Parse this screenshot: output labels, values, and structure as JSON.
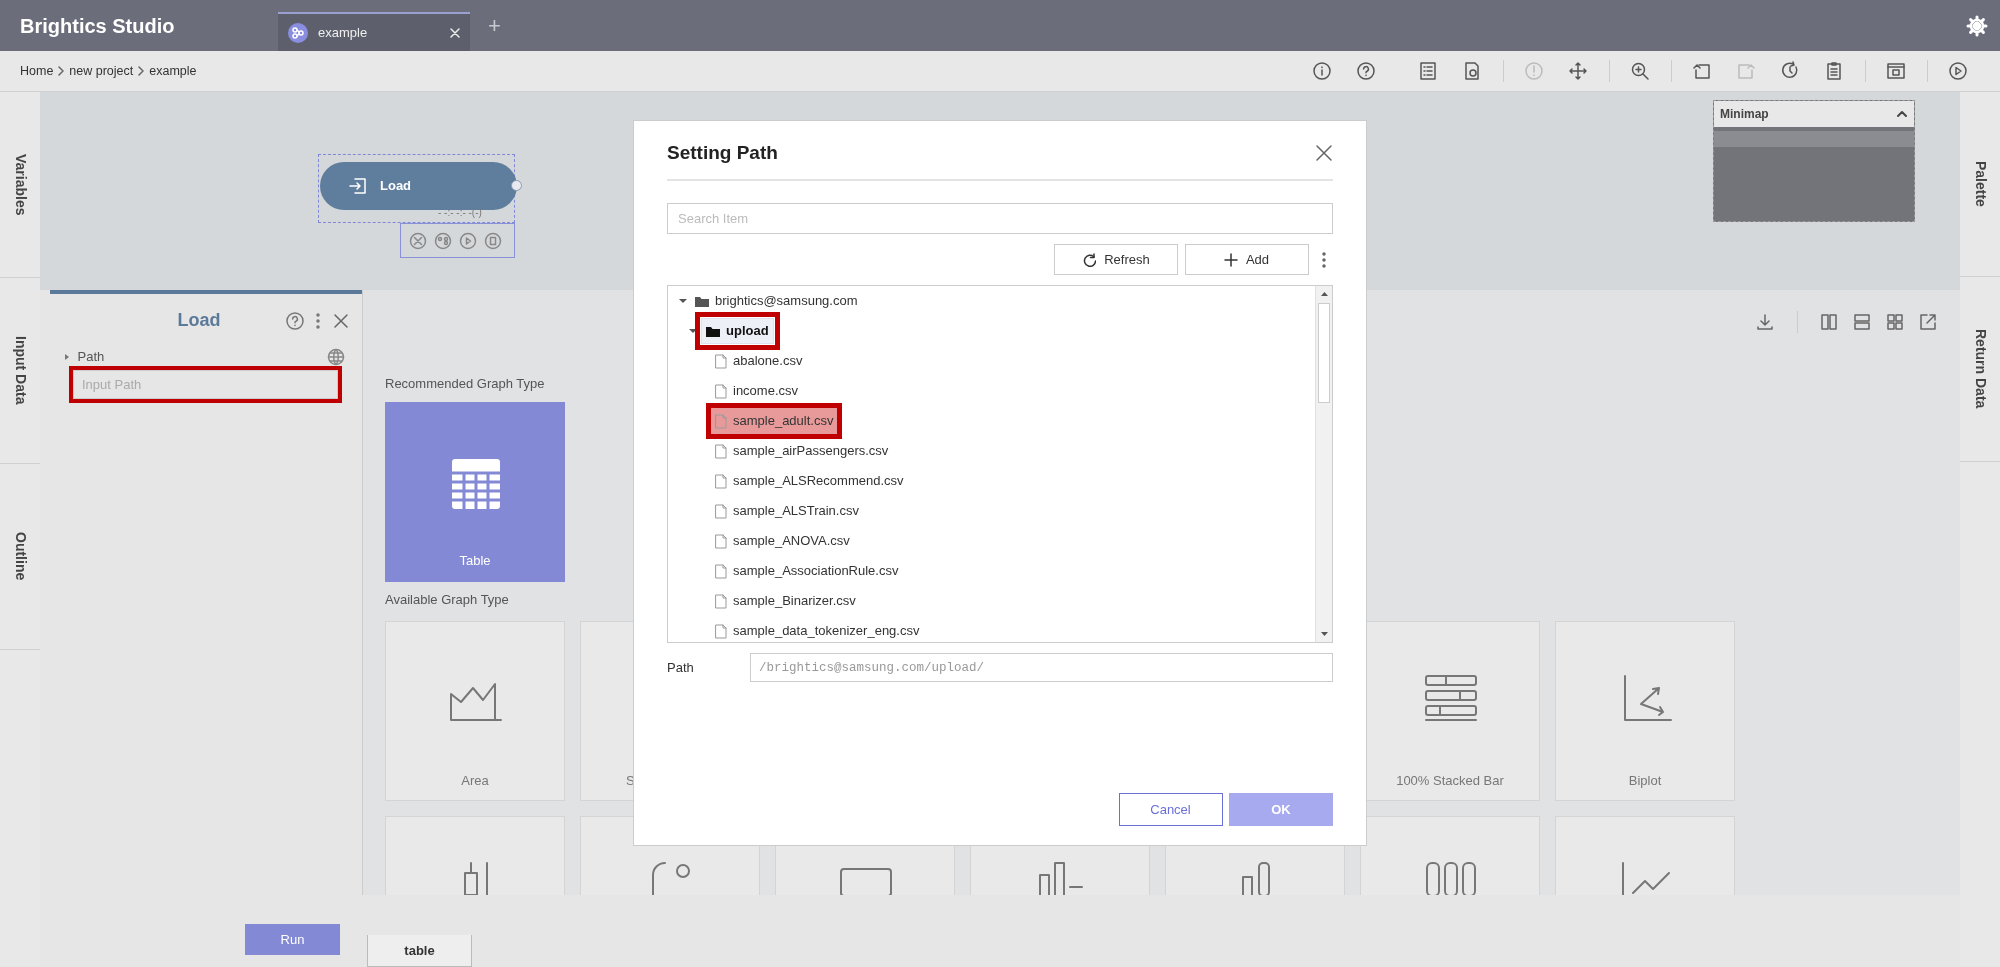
{
  "app": {
    "title": "Brightics Studio"
  },
  "tabs": [
    {
      "label": "example",
      "selected": true
    }
  ],
  "new_tab": "+",
  "breadcrumb": [
    "Home",
    "new project",
    "example"
  ],
  "toolbar": [
    {
      "disabled": false
    },
    {
      "disabled": false
    },
    {
      "disabled": false
    },
    {
      "disabled": false
    },
    {
      "disabled": true
    },
    {
      "disabled": false
    },
    {
      "disabled": false
    },
    {
      "disabled": false
    },
    {
      "disabled": true
    },
    {
      "disabled": false
    },
    {
      "disabled": false
    },
    {
      "disabled": false
    },
    {
      "disabled": false
    }
  ],
  "left_nav": [
    {
      "label": "Variables"
    },
    {
      "label": "Input Data"
    },
    {
      "label": "Outline"
    }
  ],
  "right_nav": [
    {
      "label": "Palette"
    },
    {
      "label": "Return Data"
    }
  ],
  "canvas": {
    "node": {
      "label": "Load",
      "selected": true,
      "status": "- -:- -:- -(-)"
    }
  },
  "minimap": {
    "title": "Minimap",
    "expanded": true
  },
  "panel": {
    "title": "Load",
    "param": {
      "label": "Path",
      "expanded": false,
      "placeholder": "Input Path",
      "highlighted": true
    },
    "run": "Run"
  },
  "graphs": {
    "recommended_label": "Recommended Graph Type",
    "recommended": [
      {
        "label": "Table",
        "selected": true
      }
    ],
    "available_label": "Available Graph Type",
    "available": [
      {
        "label": "Area",
        "kind": "area"
      },
      {
        "label": "S",
        "kind": "covered"
      },
      {
        "label": "100% Stacked Bar",
        "kind": "stacked-bar"
      },
      {
        "label": "Biplot",
        "kind": "biplot"
      },
      {
        "kind": "candlestick"
      },
      {
        "kind": "scatter"
      },
      {
        "kind": "box"
      },
      {
        "kind": "bar"
      },
      {
        "kind": "bar-rounded"
      },
      {
        "kind": "column"
      },
      {
        "kind": "line"
      }
    ]
  },
  "bottom_tabs": [
    {
      "label": "table",
      "selected": true
    }
  ],
  "dialog": {
    "title": "Setting Path",
    "search_placeholder": "Search Item",
    "buttons": [
      {
        "label": "Refresh",
        "kind": "refresh"
      },
      {
        "label": "Add",
        "kind": "add"
      }
    ],
    "tree": [
      {
        "label": "brightics@samsung.com",
        "kind": "folder",
        "expanded": true,
        "selected": false,
        "children": [
          {
            "label": "upload",
            "kind": "folder",
            "expanded": true,
            "selected": true,
            "highlighted": true,
            "children": [
              {
                "label": "abalone.csv",
                "kind": "file",
                "selected": false
              },
              {
                "label": "income.csv",
                "kind": "file",
                "selected": false
              },
              {
                "label": "sample_adult.csv",
                "kind": "file",
                "selected": false,
                "highlighted": true
              },
              {
                "label": "sample_airPassengers.csv",
                "kind": "file",
                "selected": false
              },
              {
                "label": "sample_ALSRecommend.csv",
                "kind": "file",
                "selected": false
              },
              {
                "label": "sample_ALSTrain.csv",
                "kind": "file",
                "selected": false
              },
              {
                "label": "sample_ANOVA.csv",
                "kind": "file",
                "selected": false
              },
              {
                "label": "sample_AssociationRule.csv",
                "kind": "file",
                "selected": false
              },
              {
                "label": "sample_Binarizer.csv",
                "kind": "file",
                "selected": false
              },
              {
                "label": "sample_data_tokenizer_eng.csv",
                "kind": "file",
                "selected": false
              }
            ]
          }
        ]
      }
    ],
    "path_label": "Path",
    "path_value": "/brightics@samsung.com/upload/",
    "actions": [
      {
        "label": "Cancel",
        "kind": "secondary"
      },
      {
        "label": "OK",
        "kind": "primary"
      }
    ]
  }
}
